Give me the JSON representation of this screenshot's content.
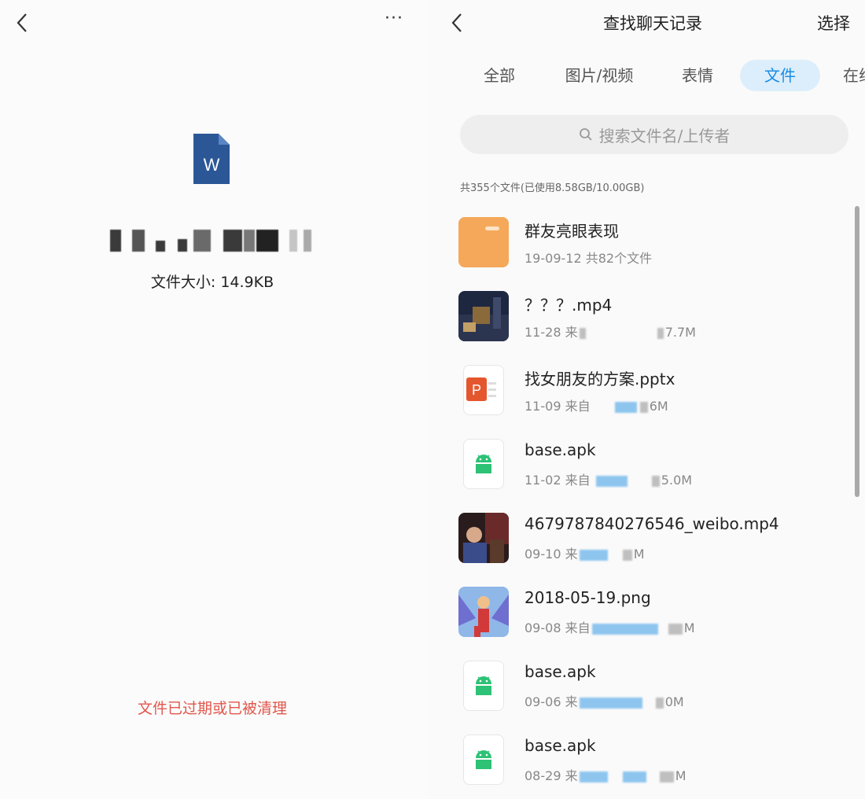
{
  "left": {
    "file_size": "文件大小: 14.9KB",
    "expired_message": "文件已过期或已被清理",
    "more_label": "···"
  },
  "right": {
    "title": "查找聊天记录",
    "select_label": "选择",
    "tabs": [
      {
        "label": "全部"
      },
      {
        "label": "图片/视频"
      },
      {
        "label": "表情"
      },
      {
        "label": "文件",
        "active": true
      },
      {
        "label": "在线"
      }
    ],
    "search_placeholder": "搜索文件名/上传者",
    "count_text": "共355个文件(已使用8.58GB/10.00GB)",
    "files": [
      {
        "name": "群友亮眼表现",
        "meta": "19-09-12 共82个文件",
        "icon": "folder-icon"
      },
      {
        "name": "？？？.mp4",
        "date": "11-28",
        "from": "来",
        "size": "7.7M",
        "icon": "video-thumbnail"
      },
      {
        "name": "找女朋友的方案.pptx",
        "date": "11-09",
        "from": "来自",
        "size": "6M",
        "icon": "ppt-icon"
      },
      {
        "name": "base.apk",
        "date": "11-02",
        "from": "来自",
        "size": "5.0M",
        "icon": "android-icon"
      },
      {
        "name": "4679787840276546_weibo.mp4",
        "date": "09-10",
        "from": "来",
        "size": "M",
        "icon": "video-thumbnail"
      },
      {
        "name": "2018-05-19.png",
        "date": "09-08",
        "from": "来自",
        "size": "M",
        "icon": "image-thumbnail"
      },
      {
        "name": "base.apk",
        "date": "09-06",
        "from": "来",
        "size": "0M",
        "icon": "android-icon"
      },
      {
        "name": "base.apk",
        "date": "08-29",
        "from": "来",
        "size": "M",
        "icon": "android-icon"
      }
    ]
  },
  "colors": {
    "accent": "#1a8ce6",
    "tab_active_bg": "#dceefb",
    "error": "#e2564b",
    "folder": "#f5a85a",
    "word": "#2b5797",
    "ppt": "#e4572e",
    "android": "#2dc275"
  }
}
